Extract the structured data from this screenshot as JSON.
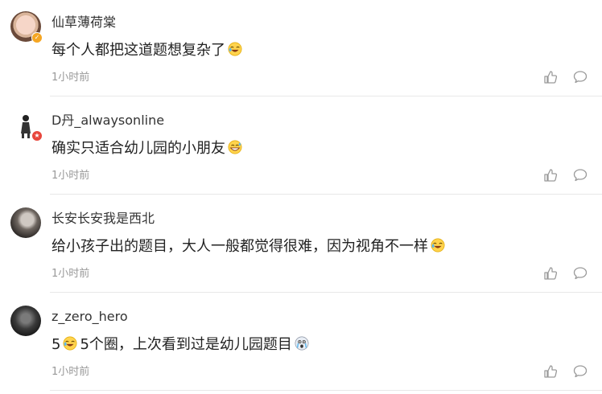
{
  "comments": [
    {
      "username": "仙草薄荷棠",
      "text_before": "每个人都把这道题想复杂了",
      "text_after": "",
      "emoji": "laugh-cry-emoji",
      "time": "1小时前"
    },
    {
      "username": "D丹_alwaysonline",
      "text_before": "确实只适合幼儿园的小朋友",
      "text_after": "",
      "emoji": "grin-sweat-emoji",
      "time": "1小时前"
    },
    {
      "username": "长安长安我是西北",
      "text_before": "给小孩子出的题目，大人一般都觉得很难，因为视角不一样",
      "text_after": "",
      "emoji": "laugh-cry-emoji",
      "time": "1小时前"
    },
    {
      "username": "z_zero_hero",
      "text_before": "5",
      "text_middle": "5个圈，上次看到过是幼儿园题目",
      "emoji": "laugh-cry-emoji",
      "emoji2": "crying-emoji",
      "time": "1小时前"
    }
  ],
  "colors": {
    "divider": "#e8e8e8",
    "muted": "#999999",
    "badge_gold": "#f5a623",
    "badge_red": "#e8473d"
  },
  "icons": {
    "like": "thumb-up-icon",
    "reply": "comment-bubble-icon"
  }
}
